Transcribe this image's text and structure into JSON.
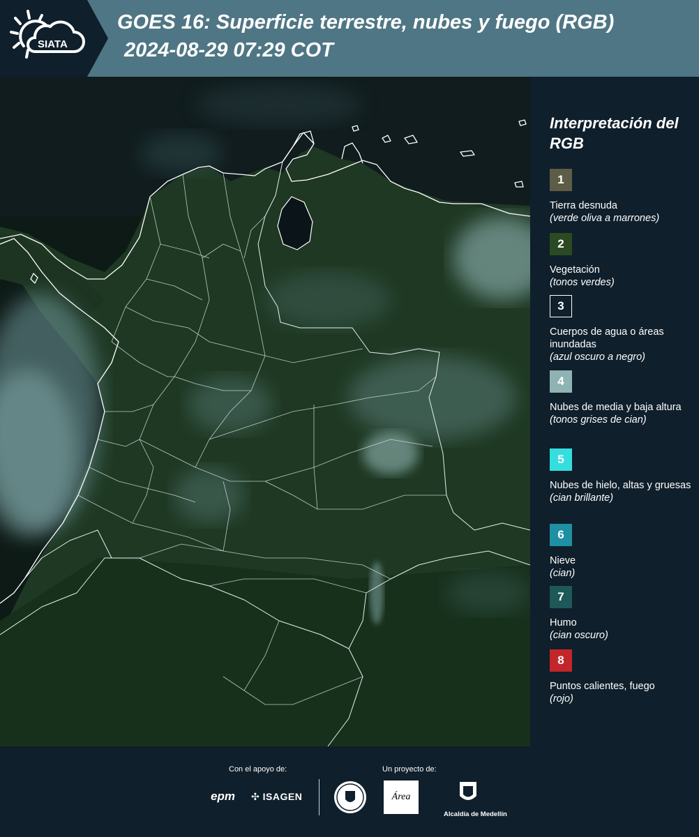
{
  "header": {
    "logo_text": "SIATA",
    "title_line1": "GOES 16: Superficie terrestre, nubes y fuego (RGB)",
    "title_line2": "2024-08-29 07:29 COT"
  },
  "legend": {
    "title": "Interpretación del RGB",
    "items": [
      {
        "number": "1",
        "label": "Tierra desnuda",
        "desc": "(verde oliva a marrones)",
        "color": "#5d5d47"
      },
      {
        "number": "2",
        "label": "Vegetación",
        "desc": "(tonos verdes)",
        "color": "#2b4a23"
      },
      {
        "number": "3",
        "label": "Cuerpos de agua o áreas inundadas",
        "desc": "(azul oscuro a negro)",
        "color": "#0f1f2b"
      },
      {
        "number": "4",
        "label": "Nubes de media y baja altura",
        "desc": "(tonos grises de cian)",
        "color": "#8fb3b2"
      },
      {
        "number": "5",
        "label": "Nubes de hielo, altas y gruesas",
        "desc": "(cian brillante)",
        "color": "#35dede"
      },
      {
        "number": "6",
        "label": "Nieve",
        "desc": "(cian)",
        "color": "#1f8fa3"
      },
      {
        "number": "7",
        "label": "Humo",
        "desc": "(cian oscuro)",
        "color": "#1e5858"
      },
      {
        "number": "8",
        "label": "Puntos calientes, fuego",
        "desc": "(rojo)",
        "color": "#c3262a"
      }
    ]
  },
  "footer": {
    "support_caption": "Con el apoyo de:",
    "project_caption": "Un proyecto de:",
    "logos": {
      "epm": "epm",
      "isagen": "ISAGEN",
      "area": "Área",
      "alcaldia": "Alcaldía de Medellín"
    }
  },
  "map": {
    "land_color": "#1f3a25",
    "ocean_color": "#0d1a16",
    "cloud_color": "#7fa6a8",
    "border_color": "#ffffff"
  }
}
